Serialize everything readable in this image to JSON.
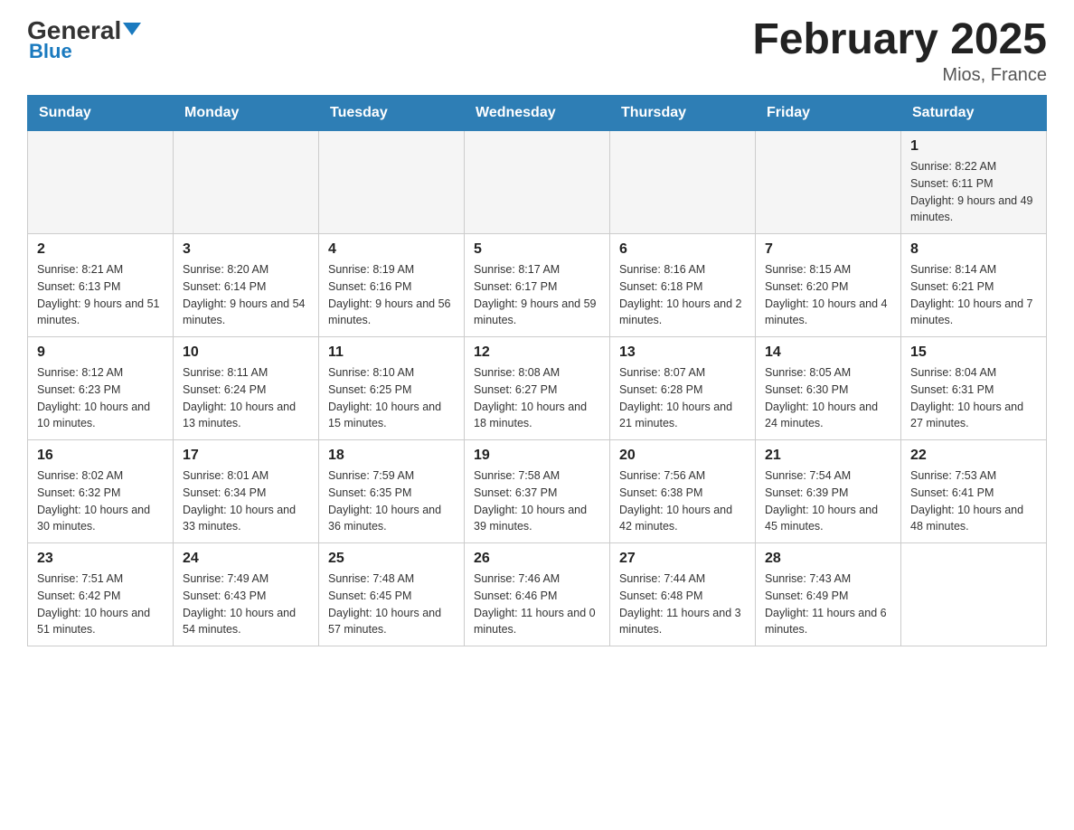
{
  "header": {
    "logo_general": "General",
    "logo_blue": "Blue",
    "month_title": "February 2025",
    "location": "Mios, France"
  },
  "weekdays": [
    "Sunday",
    "Monday",
    "Tuesday",
    "Wednesday",
    "Thursday",
    "Friday",
    "Saturday"
  ],
  "weeks": [
    {
      "days": [
        {
          "number": "",
          "info": ""
        },
        {
          "number": "",
          "info": ""
        },
        {
          "number": "",
          "info": ""
        },
        {
          "number": "",
          "info": ""
        },
        {
          "number": "",
          "info": ""
        },
        {
          "number": "",
          "info": ""
        },
        {
          "number": "1",
          "info": "Sunrise: 8:22 AM\nSunset: 6:11 PM\nDaylight: 9 hours and 49 minutes."
        }
      ]
    },
    {
      "days": [
        {
          "number": "2",
          "info": "Sunrise: 8:21 AM\nSunset: 6:13 PM\nDaylight: 9 hours and 51 minutes."
        },
        {
          "number": "3",
          "info": "Sunrise: 8:20 AM\nSunset: 6:14 PM\nDaylight: 9 hours and 54 minutes."
        },
        {
          "number": "4",
          "info": "Sunrise: 8:19 AM\nSunset: 6:16 PM\nDaylight: 9 hours and 56 minutes."
        },
        {
          "number": "5",
          "info": "Sunrise: 8:17 AM\nSunset: 6:17 PM\nDaylight: 9 hours and 59 minutes."
        },
        {
          "number": "6",
          "info": "Sunrise: 8:16 AM\nSunset: 6:18 PM\nDaylight: 10 hours and 2 minutes."
        },
        {
          "number": "7",
          "info": "Sunrise: 8:15 AM\nSunset: 6:20 PM\nDaylight: 10 hours and 4 minutes."
        },
        {
          "number": "8",
          "info": "Sunrise: 8:14 AM\nSunset: 6:21 PM\nDaylight: 10 hours and 7 minutes."
        }
      ]
    },
    {
      "days": [
        {
          "number": "9",
          "info": "Sunrise: 8:12 AM\nSunset: 6:23 PM\nDaylight: 10 hours and 10 minutes."
        },
        {
          "number": "10",
          "info": "Sunrise: 8:11 AM\nSunset: 6:24 PM\nDaylight: 10 hours and 13 minutes."
        },
        {
          "number": "11",
          "info": "Sunrise: 8:10 AM\nSunset: 6:25 PM\nDaylight: 10 hours and 15 minutes."
        },
        {
          "number": "12",
          "info": "Sunrise: 8:08 AM\nSunset: 6:27 PM\nDaylight: 10 hours and 18 minutes."
        },
        {
          "number": "13",
          "info": "Sunrise: 8:07 AM\nSunset: 6:28 PM\nDaylight: 10 hours and 21 minutes."
        },
        {
          "number": "14",
          "info": "Sunrise: 8:05 AM\nSunset: 6:30 PM\nDaylight: 10 hours and 24 minutes."
        },
        {
          "number": "15",
          "info": "Sunrise: 8:04 AM\nSunset: 6:31 PM\nDaylight: 10 hours and 27 minutes."
        }
      ]
    },
    {
      "days": [
        {
          "number": "16",
          "info": "Sunrise: 8:02 AM\nSunset: 6:32 PM\nDaylight: 10 hours and 30 minutes."
        },
        {
          "number": "17",
          "info": "Sunrise: 8:01 AM\nSunset: 6:34 PM\nDaylight: 10 hours and 33 minutes."
        },
        {
          "number": "18",
          "info": "Sunrise: 7:59 AM\nSunset: 6:35 PM\nDaylight: 10 hours and 36 minutes."
        },
        {
          "number": "19",
          "info": "Sunrise: 7:58 AM\nSunset: 6:37 PM\nDaylight: 10 hours and 39 minutes."
        },
        {
          "number": "20",
          "info": "Sunrise: 7:56 AM\nSunset: 6:38 PM\nDaylight: 10 hours and 42 minutes."
        },
        {
          "number": "21",
          "info": "Sunrise: 7:54 AM\nSunset: 6:39 PM\nDaylight: 10 hours and 45 minutes."
        },
        {
          "number": "22",
          "info": "Sunrise: 7:53 AM\nSunset: 6:41 PM\nDaylight: 10 hours and 48 minutes."
        }
      ]
    },
    {
      "days": [
        {
          "number": "23",
          "info": "Sunrise: 7:51 AM\nSunset: 6:42 PM\nDaylight: 10 hours and 51 minutes."
        },
        {
          "number": "24",
          "info": "Sunrise: 7:49 AM\nSunset: 6:43 PM\nDaylight: 10 hours and 54 minutes."
        },
        {
          "number": "25",
          "info": "Sunrise: 7:48 AM\nSunset: 6:45 PM\nDaylight: 10 hours and 57 minutes."
        },
        {
          "number": "26",
          "info": "Sunrise: 7:46 AM\nSunset: 6:46 PM\nDaylight: 11 hours and 0 minutes."
        },
        {
          "number": "27",
          "info": "Sunrise: 7:44 AM\nSunset: 6:48 PM\nDaylight: 11 hours and 3 minutes."
        },
        {
          "number": "28",
          "info": "Sunrise: 7:43 AM\nSunset: 6:49 PM\nDaylight: 11 hours and 6 minutes."
        },
        {
          "number": "",
          "info": ""
        }
      ]
    }
  ]
}
